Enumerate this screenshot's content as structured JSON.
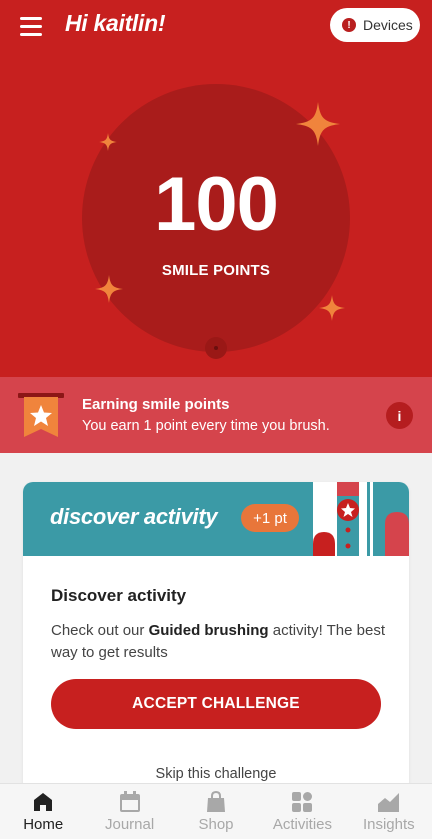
{
  "header": {
    "greeting": "Hi kaitlin!",
    "devices_label": "Devices",
    "devices_alert": "!"
  },
  "points": {
    "value": "100",
    "label": "SMILE POINTS"
  },
  "info": {
    "title": "Earning smile points",
    "text": "You earn 1 point every time you brush.",
    "info_glyph": "i"
  },
  "activity_card": {
    "banner_title": "discover activity",
    "points_pill": "+1 pt",
    "heading": "Discover activity",
    "desc_prefix": "Check out our ",
    "desc_bold": "Guided brushing",
    "desc_suffix": " activity! The best way to get results",
    "accept_label": "ACCEPT CHALLENGE",
    "skip_label": "Skip this challenge"
  },
  "tabs": [
    {
      "label": "Home",
      "icon": "home-icon",
      "active": true
    },
    {
      "label": "Journal",
      "icon": "calendar-icon",
      "active": false
    },
    {
      "label": "Shop",
      "icon": "shopping-bag-icon",
      "active": false
    },
    {
      "label": "Activities",
      "icon": "grid-icon",
      "active": false
    },
    {
      "label": "Insights",
      "icon": "chart-icon",
      "active": false
    }
  ],
  "colors": {
    "brand_red": "#c7201f",
    "info_strip": "#d5444c",
    "banner_teal": "#3b9aa6",
    "accent_orange": "#f0843c"
  }
}
